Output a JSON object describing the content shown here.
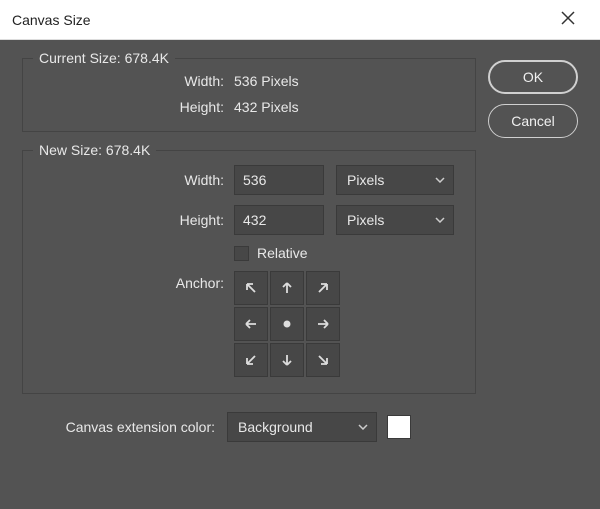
{
  "title": "Canvas Size",
  "buttons": {
    "ok": "OK",
    "cancel": "Cancel"
  },
  "currentSize": {
    "legend": "Current Size: 678.4K",
    "widthLabel": "Width:",
    "widthValue": "536 Pixels",
    "heightLabel": "Height:",
    "heightValue": "432 Pixels"
  },
  "newSize": {
    "legend": "New Size: 678.4K",
    "widthLabel": "Width:",
    "widthValue": "536",
    "widthUnit": "Pixels",
    "heightLabel": "Height:",
    "heightValue": "432",
    "heightUnit": "Pixels",
    "relativeLabel": "Relative",
    "anchorLabel": "Anchor:"
  },
  "extension": {
    "label": "Canvas extension color:",
    "value": "Background",
    "swatch": "#ffffff"
  }
}
